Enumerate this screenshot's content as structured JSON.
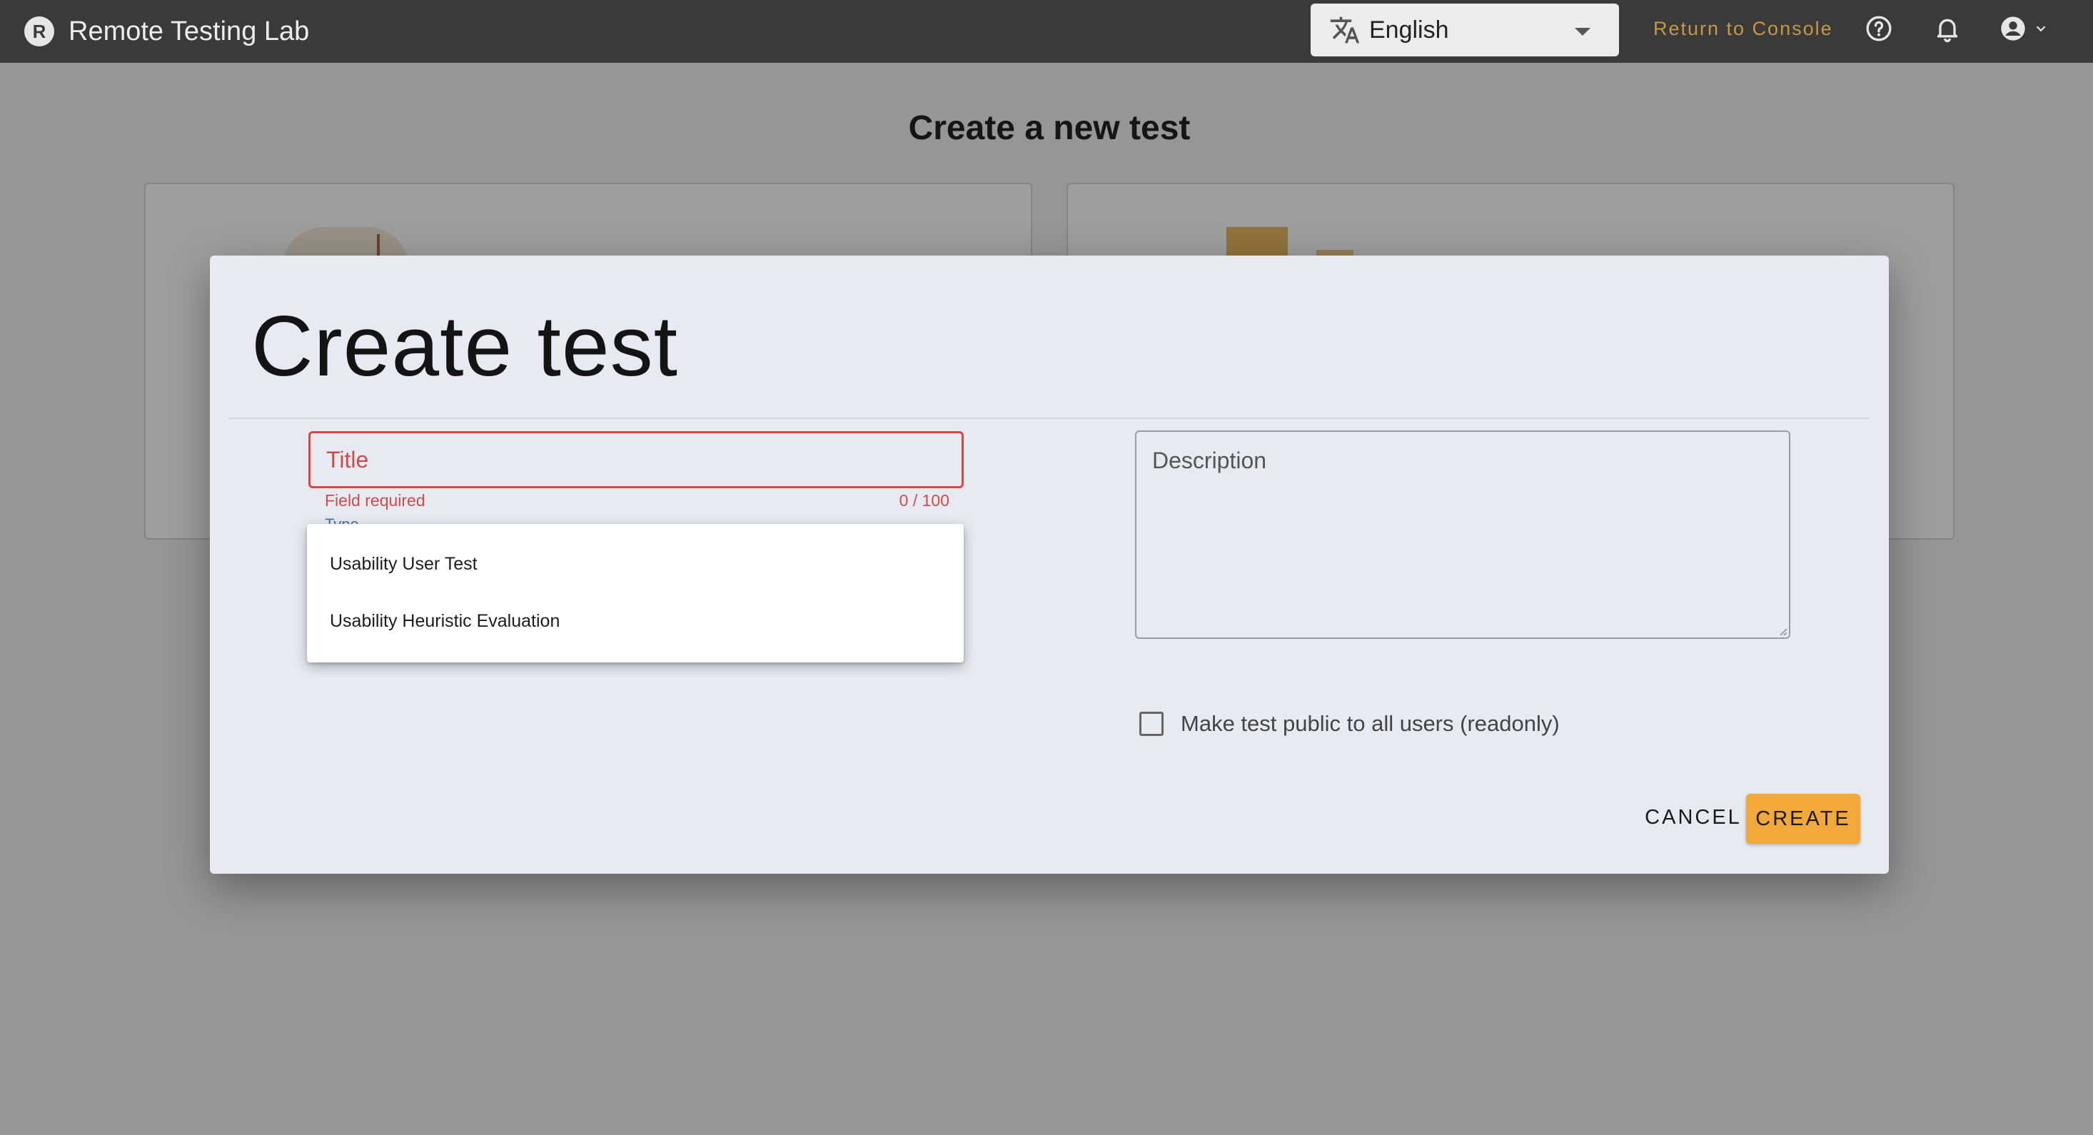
{
  "app": {
    "name": "Remote Testing Lab",
    "logo_letter": "R"
  },
  "header": {
    "language": {
      "value": "English",
      "icon": "translate-icon"
    },
    "return_link": "Return to Console",
    "icons": [
      "help-icon",
      "notifications-icon",
      "account-icon"
    ]
  },
  "page": {
    "title": "Create a new test"
  },
  "dialog": {
    "title": "Create test",
    "title_field": {
      "placeholder": "Title",
      "value": "",
      "hint": "Field required",
      "counter": "0 / 100"
    },
    "type_field": {
      "label": "Type",
      "options": [
        "Usability User Test",
        "Usability Heuristic Evaluation"
      ]
    },
    "description_field": {
      "placeholder": "Description",
      "value": ""
    },
    "public_checkbox": {
      "label": "Make test public to all users (readonly)",
      "checked": false
    },
    "actions": {
      "cancel": "CANCEL",
      "create": "CREATE"
    }
  },
  "colors": {
    "appbar": "#3a3a3a",
    "accent": "#f0a93a",
    "link": "#c79744",
    "error": "#d14a4a",
    "focus": "#4f6fb8",
    "dialog_bg": "#e8eaf2"
  }
}
